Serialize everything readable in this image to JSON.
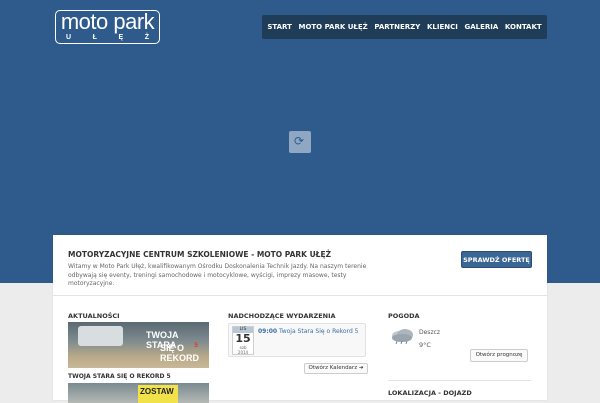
{
  "logo": {
    "title": "moto park",
    "subtitle_letters": [
      "U",
      "Ł",
      "Ę",
      "Ż"
    ]
  },
  "nav": {
    "items": [
      "START",
      "MOTO PARK UŁĘŻ",
      "PARTNERZY",
      "KLIENCI",
      "GALERIA",
      "KONTAKT"
    ]
  },
  "intro": {
    "title": "MOTORYZACYJNE CENTRUM SZKOLENIOWE - MOTO PARK UŁĘŻ",
    "text": "Witamy w Moto Park Ułęż, kwalifikowanym Ośrodku Doskonalenia Technik Jazdy. Na naszym terenie odbywają się eventy, treningi samochodowe i motocyklowe, wyścigi, imprezy masowe, testy motoryzacyjne.",
    "button": "SPRAWDŹ OFERTĘ"
  },
  "news": {
    "title": "AKTUALNOŚCI",
    "image_text_1": "TWOJA STARA",
    "image_text_2": "SIĘ O REKORD",
    "image_text_num": "5",
    "caption": "TWOJA STARA SIĘ O REKORD 5",
    "image2_text": "ZOSTAW"
  },
  "events": {
    "title": "NADCHODZĄCE WYDARZENIA",
    "month": "LIS",
    "day": "15",
    "weekday": "sob",
    "year": "2014",
    "time": "09:00",
    "name": "Twoja Stara Się o Rekord 5",
    "calendar_button": "Otwórz Kalendarz"
  },
  "weather": {
    "title": "POGODA",
    "icon": "rain-cloud-icon",
    "description": "Deszcz",
    "temperature": "9°C",
    "forecast_button": "Otwórz prognozę"
  },
  "location": {
    "title": "LOKALIZACJA - DOJAZD"
  },
  "colors": {
    "hero": "#2e5b8c",
    "nav": "#1f3c59",
    "button": "#3a6694",
    "link": "#3a6fa5"
  }
}
